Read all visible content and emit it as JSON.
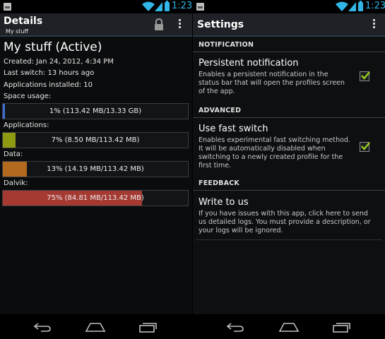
{
  "colors": {
    "accent": "#31b6e7",
    "space_bar": "#3f6fd0",
    "applications_bar": "#8e9a12",
    "data_bar": "#b36a1e",
    "dalvik_bar": "#a53a33",
    "checkmark": "#9acd1f"
  },
  "status_bar": {
    "time": "1:23",
    "icons": [
      "notification-icon",
      "wifi-icon",
      "signal-icon",
      "battery-icon"
    ]
  },
  "details_screen": {
    "title": "Details",
    "subtitle": "My stuff",
    "action_icons": [
      "lock-icon",
      "overflow-menu-icon"
    ],
    "profile_name": "My stuff (Active)",
    "created": "Created: Jan 24, 2012, 4:34 PM",
    "last_switch": "Last switch: 13 hours ago",
    "apps_installed": "Applications installed: 10",
    "usage": [
      {
        "label": "Space usage:",
        "text": "1% (113.42 MB/13.33 GB)",
        "fraction": 0.01
      },
      {
        "label": "Applications:",
        "text": "7% (8.50 MB/113.42 MB)",
        "fraction": 0.07
      },
      {
        "label": "Data:",
        "text": "13% (14.19 MB/113.42 MB)",
        "fraction": 0.13
      },
      {
        "label": "Dalvik:",
        "text": "75% (84.81 MB/113.42 MB)",
        "fraction": 0.75
      }
    ]
  },
  "settings_screen": {
    "title": "Settings",
    "action_icons": [
      "overflow-menu-icon"
    ],
    "sections": {
      "notification": "NOTIFICATION",
      "advanced": "ADVANCED",
      "feedback": "FEEDBACK"
    },
    "persistent_notification": {
      "title": "Persistent notification",
      "summary": [
        "Enables a persistent notification in the",
        "status bar that will open the profiles screen",
        "of the app."
      ],
      "checked": true
    },
    "fast_switch": {
      "title": "Use fast switch",
      "summary": [
        "Enables experimental fast switching method.",
        "It will be automatically disabled when",
        "switching to a newly created profile for the",
        "first time."
      ],
      "checked": true
    },
    "write_to_us": {
      "title": "Write to us",
      "summary": [
        "If you have issues with this app, click here to send",
        "us detailed logs. You must provide a description, or",
        "your logs will be ignored."
      ]
    }
  },
  "nav_bar": {
    "buttons": [
      "back-icon",
      "home-icon",
      "recent-apps-icon"
    ]
  }
}
